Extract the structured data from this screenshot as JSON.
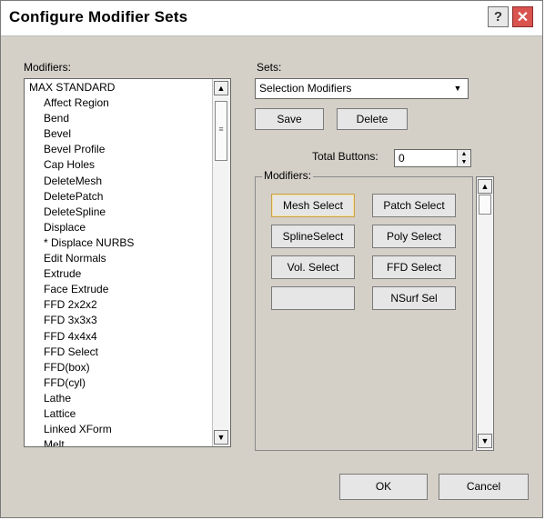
{
  "window": {
    "title": "Configure Modifier Sets"
  },
  "titlebar": {
    "help_symbol": "?",
    "close_symbol": "✕"
  },
  "modifiers_panel": {
    "label": "Modifiers:",
    "items": [
      "MAX STANDARD",
      "Affect Region",
      "Bend",
      "Bevel",
      "Bevel Profile",
      "Cap Holes",
      "DeleteMesh",
      "DeletePatch",
      "DeleteSpline",
      "Displace",
      "* Displace NURBS",
      "Edit Normals",
      "Extrude",
      "Face Extrude",
      "FFD 2x2x2",
      "FFD 3x3x3",
      "FFD 4x4x4",
      "FFD Select",
      "FFD(box)",
      "FFD(cyl)",
      "Lathe",
      "Lattice",
      "Linked XForm",
      "Melt"
    ]
  },
  "sets_panel": {
    "label": "Sets:",
    "selected": "Selection Modifiers",
    "save_label": "Save",
    "delete_label": "Delete",
    "total_buttons_label": "Total Buttons:",
    "total_buttons_value": "0"
  },
  "modifiers_group": {
    "title": "Modifiers:",
    "buttons": [
      "Mesh Select",
      "Patch Select",
      "SplineSelect",
      "Poly Select",
      "Vol. Select",
      "FFD Select",
      "",
      "NSurf Sel"
    ]
  },
  "footer": {
    "ok_label": "OK",
    "cancel_label": "Cancel"
  }
}
